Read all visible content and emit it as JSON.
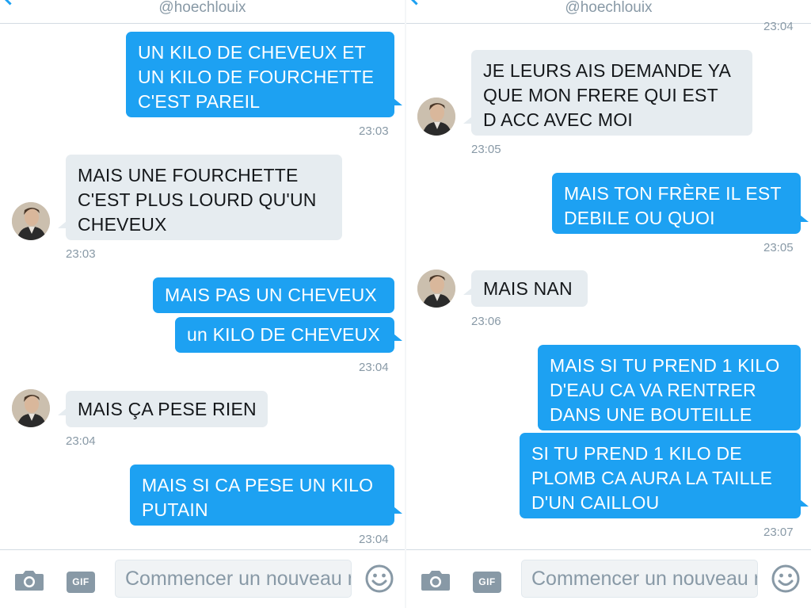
{
  "left_pane": {
    "header_handle": "@hoechlouix",
    "messages": [
      {
        "text": "UN KILO DE CHEVEUX ET\nUN KILO DE FOURCHETTE\nC'EST PAREIL",
        "direction": "sent"
      },
      {
        "text": "MAIS UNE FOURCHETTE\nC'EST PLUS LOURD QU'UN\nCHEVEUX",
        "direction": "received"
      },
      {
        "text": "MAIS PAS UN CHEVEUX",
        "direction": "sent"
      },
      {
        "text": "un KILO DE CHEVEUX",
        "direction": "sent"
      },
      {
        "text": "MAIS ÇA PESE RIEN",
        "direction": "received"
      },
      {
        "text": "MAIS SI CA PESE UN KILO\nPUTAIN",
        "direction": "sent"
      }
    ],
    "timestamps": [
      "23:03",
      "23:03",
      "23:04",
      "23:04",
      "23:04"
    ],
    "composer": {
      "placeholder": "Commencer un nouveau message",
      "gif_label": "GIF"
    }
  },
  "right_pane": {
    "header_handle": "@hoechlouix",
    "messages": [
      {
        "text": "JE LEURS AIS DEMANDE YA\nQUE MON FRERE QUI EST\nD ACC AVEC MOI",
        "direction": "received"
      },
      {
        "text": "MAIS TON FRÈRE IL EST\nDEBILE OU QUOI",
        "direction": "sent"
      },
      {
        "text": "MAIS NAN",
        "direction": "received"
      },
      {
        "text": "MAIS SI TU PREND 1 KILO\nD'EAU CA VA RENTRER\nDANS UNE BOUTEILLE",
        "direction": "sent"
      },
      {
        "text": "SI TU PREND 1 KILO DE\nPLOMB CA AURA LA TAILLE\nD'UN CAILLOU",
        "direction": "sent"
      }
    ],
    "timestamps": [
      "23:04",
      "23:05",
      "23:05",
      "23:06",
      "23:07"
    ],
    "composer": {
      "placeholder": "Commencer un nouveau message",
      "gif_label": "GIF"
    }
  },
  "colors": {
    "accent": "#1da1f2",
    "received_bubble": "#e6ecf0",
    "timestamp": "#8899a6",
    "divider": "#d3dbe2"
  }
}
